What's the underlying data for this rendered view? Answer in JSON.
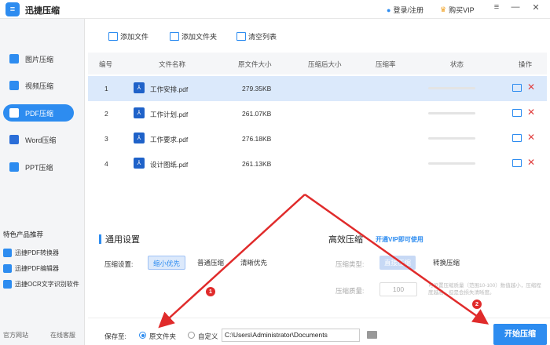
{
  "app": {
    "title": "迅捷压缩",
    "logo_glyph": "≡"
  },
  "header": {
    "login": "登录/注册",
    "vip": "购买VIP"
  },
  "sidebar": {
    "items": [
      {
        "label": "图片压缩",
        "icon": "image-icon",
        "color": "#2d8cf0"
      },
      {
        "label": "视频压缩",
        "icon": "video-icon",
        "color": "#2d8cf0"
      },
      {
        "label": "PDF压缩",
        "icon": "pdf-icon",
        "color": "#ffffff",
        "active": true
      },
      {
        "label": "Word压缩",
        "icon": "word-icon",
        "color": "#2b6ed8"
      },
      {
        "label": "PPT压缩",
        "icon": "ppt-icon",
        "color": "#2d8cf0"
      }
    ],
    "promo_title": "特色产品推荐",
    "promo": [
      {
        "label": "迅捷PDF转换器",
        "color": "#2d8cf0"
      },
      {
        "label": "迅捷PDF编辑器",
        "color": "#2d8cf0"
      },
      {
        "label": "迅捷OCR文字识别软件",
        "color": "#2d8cf0"
      }
    ],
    "footer": {
      "website": "官方网站",
      "support": "在线客服"
    }
  },
  "toolbar": {
    "add_file": "添加文件",
    "add_folder": "添加文件夹",
    "clear_list": "清空列表"
  },
  "table": {
    "headers": [
      "编号",
      "文件名称",
      "原文件大小",
      "压缩后大小",
      "压缩率",
      "状态",
      "操作"
    ],
    "rows": [
      {
        "no": "1",
        "name": "工作安排.pdf",
        "size": "279.35KB"
      },
      {
        "no": "2",
        "name": "工作计划.pdf",
        "size": "261.07KB"
      },
      {
        "no": "3",
        "name": "工作要求.pdf",
        "size": "276.18KB"
      },
      {
        "no": "4",
        "name": "设计图纸.pdf",
        "size": "261.13KB"
      }
    ]
  },
  "settings": {
    "general_title": "通用设置",
    "compress_label": "压缩设置:",
    "options": [
      "缩小优先",
      "普通压缩",
      "清晰优先"
    ],
    "advanced_title": "高效压缩",
    "vip_link": "开通VIP即可使用",
    "type_label": "压缩类型:",
    "type_options": [
      "直接压缩",
      "转换压缩"
    ],
    "quality_label": "压缩质量:",
    "quality_value": "100",
    "hint": "可设置压缩质量（范围10-100）数值越小，压缩程度越高，但是会损失清晰度。"
  },
  "save": {
    "label": "保存至:",
    "original": "原文件夹",
    "custom": "自定义",
    "path": "C:\\Users\\Administrator\\Documents"
  },
  "start_button": "开始压缩",
  "annotations": {
    "badge1": "1",
    "badge2": "2"
  },
  "colors": {
    "accent": "#2d8cf0",
    "danger": "#e03e3e",
    "arrow": "#e02b2b"
  }
}
